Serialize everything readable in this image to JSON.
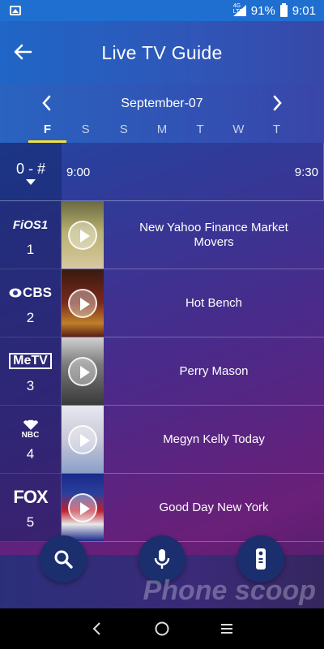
{
  "status_bar": {
    "network": "4G LTE",
    "battery": "91%",
    "time": "9:01"
  },
  "header": {
    "title": "Live TV Guide",
    "back_icon": "arrow-left-icon"
  },
  "date_nav": {
    "date": "September-07",
    "days": [
      {
        "label": "F",
        "active": true
      },
      {
        "label": "S",
        "active": false
      },
      {
        "label": "S",
        "active": false
      },
      {
        "label": "M",
        "active": false
      },
      {
        "label": "T",
        "active": false
      },
      {
        "label": "W",
        "active": false
      },
      {
        "label": "T",
        "active": false
      }
    ],
    "accent_color": "#f3e23a"
  },
  "guide": {
    "sort_label": "0 - #",
    "times": [
      "9:00",
      "9:30"
    ],
    "rows": [
      {
        "logo": "FiOS1",
        "channel": "1",
        "show": "New Yahoo Finance Market Movers",
        "thumb_color": "#b8b070"
      },
      {
        "logo": "CBS",
        "channel": "2",
        "show": "Hot Bench",
        "thumb_color": "#7a2a1a"
      },
      {
        "logo": "MeTV",
        "channel": "3",
        "show": "Perry Mason",
        "thumb_color": "#5a5a5a"
      },
      {
        "logo": "NBC",
        "channel": "4",
        "show": "Megyn Kelly Today",
        "thumb_color": "#c8c8d8"
      },
      {
        "logo": "FOX",
        "channel": "5",
        "show": "Good Day New York",
        "thumb_color": "#2a3f9c"
      }
    ]
  },
  "actions": [
    "search-icon",
    "microphone-icon",
    "remote-icon"
  ],
  "watermark": "Phone scoop"
}
